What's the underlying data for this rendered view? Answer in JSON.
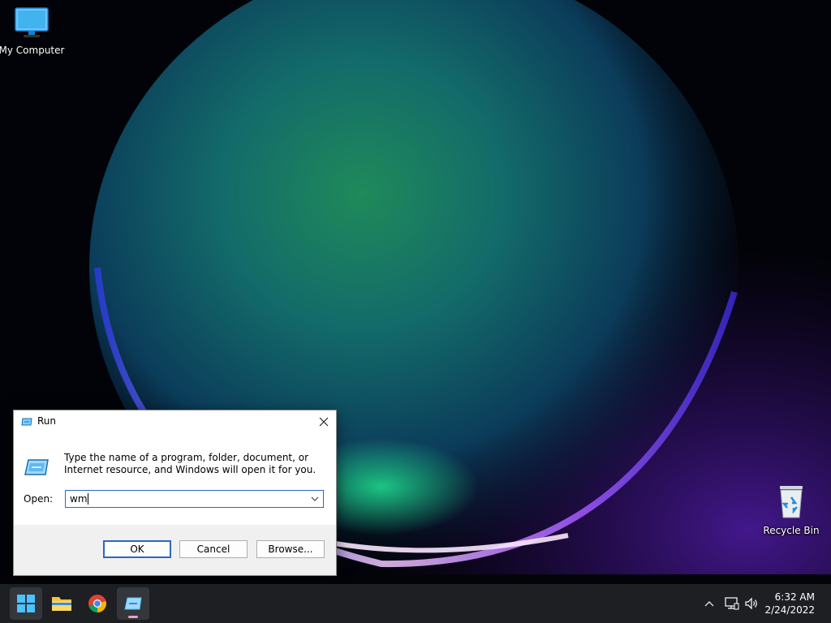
{
  "desktop": {
    "icons": [
      {
        "label": "My Computer",
        "icon": "computer-monitor-icon"
      },
      {
        "label": "Recycle Bin",
        "icon": "recycle-bin-icon"
      }
    ]
  },
  "run_dialog": {
    "title": "Run",
    "description": "Type the name of a program, folder, document, or Internet resource, and Windows will open it for you.",
    "open_label": "Open:",
    "open_value": "wm",
    "ok_label": "OK",
    "cancel_label": "Cancel",
    "browse_label": "Browse..."
  },
  "taskbar": {
    "apps": [
      "start-icon",
      "file-explorer-icon",
      "chrome-icon",
      "run-icon"
    ],
    "tray_icons": [
      "chevron-up-icon",
      "network-icon",
      "volume-icon"
    ],
    "time": "6:32 AM",
    "date": "2/24/2022"
  },
  "colors": {
    "accent": "#2a68c4",
    "taskbar": "#1e1f22",
    "dialog_footer": "#f0f0f0"
  }
}
